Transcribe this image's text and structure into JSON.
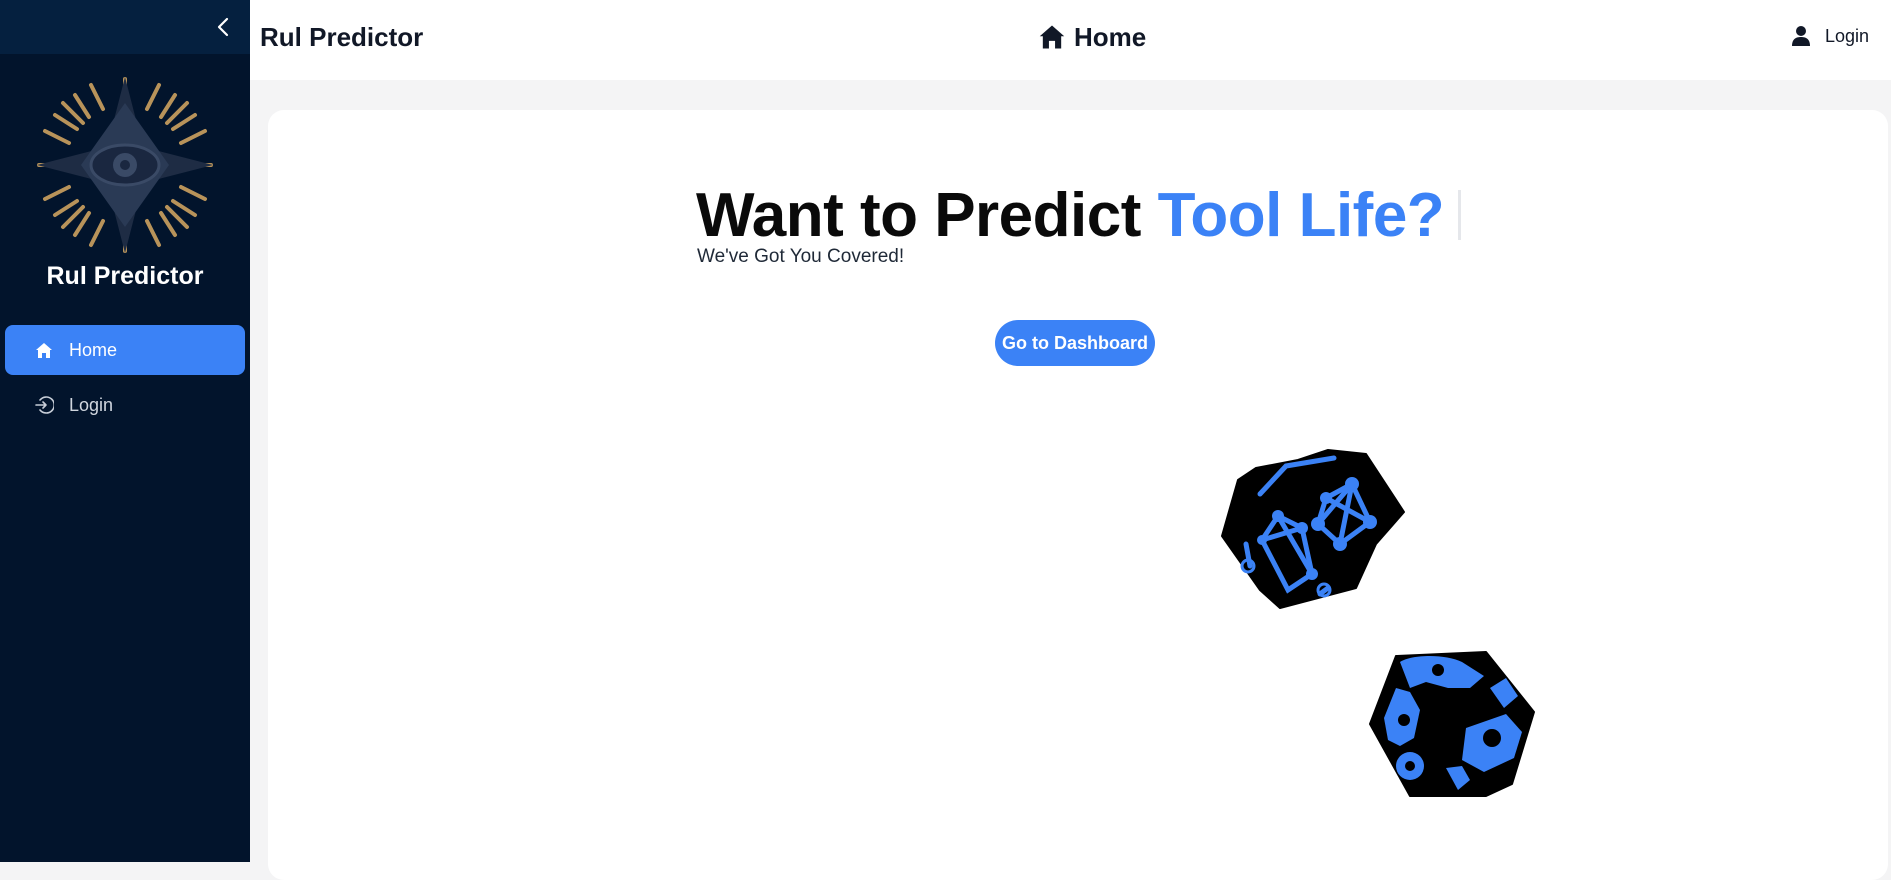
{
  "sidebar": {
    "title": "Rul Predictor",
    "items": [
      {
        "label": "Home",
        "icon": "home-icon",
        "active": true
      },
      {
        "label": "Login",
        "icon": "login-icon",
        "active": false
      }
    ]
  },
  "header": {
    "brand": "Rul Predictor",
    "page_title": "Home",
    "login_label": "Login"
  },
  "hero": {
    "title_part1": "Want to Predict ",
    "title_accent": "Tool Life?",
    "subtitle": "We've Got You Covered!",
    "button_label": "Go to Dashboard"
  },
  "colors": {
    "accent": "#3b82f6",
    "sidebar_bg": "#02142c",
    "logo_gold": "#b8935a"
  }
}
